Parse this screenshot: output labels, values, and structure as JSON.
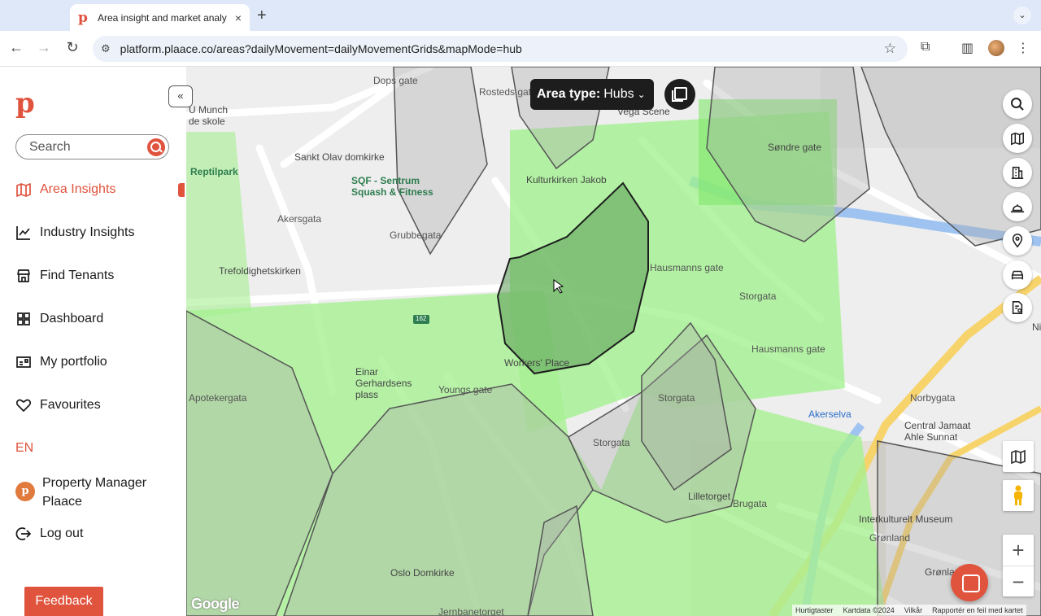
{
  "browser": {
    "tab_title": "Area insight and market analy",
    "tab_favicon": "p",
    "tab_close": "×",
    "new_tab": "+",
    "url": "platform.plaace.co/areas?dailyMovement=dailyMovementGrids&mapMode=hub"
  },
  "sidebar": {
    "logo": "p",
    "collapse_label": "«",
    "search_placeholder": "Search",
    "items": [
      {
        "label": "Area Insights",
        "icon": "map-icon",
        "active": true
      },
      {
        "label": "Industry Insights",
        "icon": "chart-icon",
        "active": false
      },
      {
        "label": "Find Tenants",
        "icon": "store-icon",
        "active": false
      },
      {
        "label": "Dashboard",
        "icon": "grid-icon",
        "active": false
      },
      {
        "label": "My portfolio",
        "icon": "id-card-icon",
        "active": false
      },
      {
        "label": "Favourites",
        "icon": "heart-icon",
        "active": false
      }
    ],
    "language": "EN",
    "profile_line1": "Property Manager",
    "profile_line2": "Plaace",
    "logout": "Log out",
    "feedback": "Feedback"
  },
  "map": {
    "area_type_label": "Area type:",
    "area_type_value": "Hubs",
    "google": "Google",
    "attribution": [
      "Hurtigtaster",
      "Kartdata ©2024",
      "Vilkår",
      "Rapportér en feil med kartet"
    ],
    "zoom_in": "+",
    "zoom_out": "−",
    "labels": {
      "munch": "U Munch",
      "skole": "de skole",
      "dops": "Dops gate",
      "rosteds": "Rosteds gate",
      "vega": "Vega Scene",
      "sandre": "Søndre gate",
      "sankt": "Sankt Olav domkirke",
      "reptil": "Reptilpark",
      "sqf1": "SQF - Sentrum",
      "sqf2": "Squash & Fitness",
      "kultur": "Kulturkirken Jakob",
      "trefold": "Trefoldighetskirken",
      "workers": "Workers' Place",
      "einar1": "Einar",
      "einar2": "Gerhardsens",
      "einar3": "plass",
      "apotek": "Apotekergata",
      "lilletorget": "Lilletorget",
      "interkult": "Interkulturelt Museum",
      "gronland": "Grønland",
      "gronland2": "Grønland",
      "oslodom": "Oslo Domkirke",
      "jern": "Jernbanetorget",
      "central1": "Central Jamaat",
      "central2": "Ahle Sunnat",
      "nilse": "Nilse",
      "storgata": "Storgata",
      "storgata2": "Storgata",
      "storgata3": "Storgata",
      "hausmanns": "Hausmanns gate",
      "hausmanns2": "Hausmanns gate",
      "akersgata": "Akersgata",
      "grubbegata": "Grubbegata",
      "akerselva": "Akerselva",
      "norbygata": "Norbygata",
      "brugata": "Brugata",
      "youngs": "Youngs gate",
      "road162": "162"
    }
  }
}
